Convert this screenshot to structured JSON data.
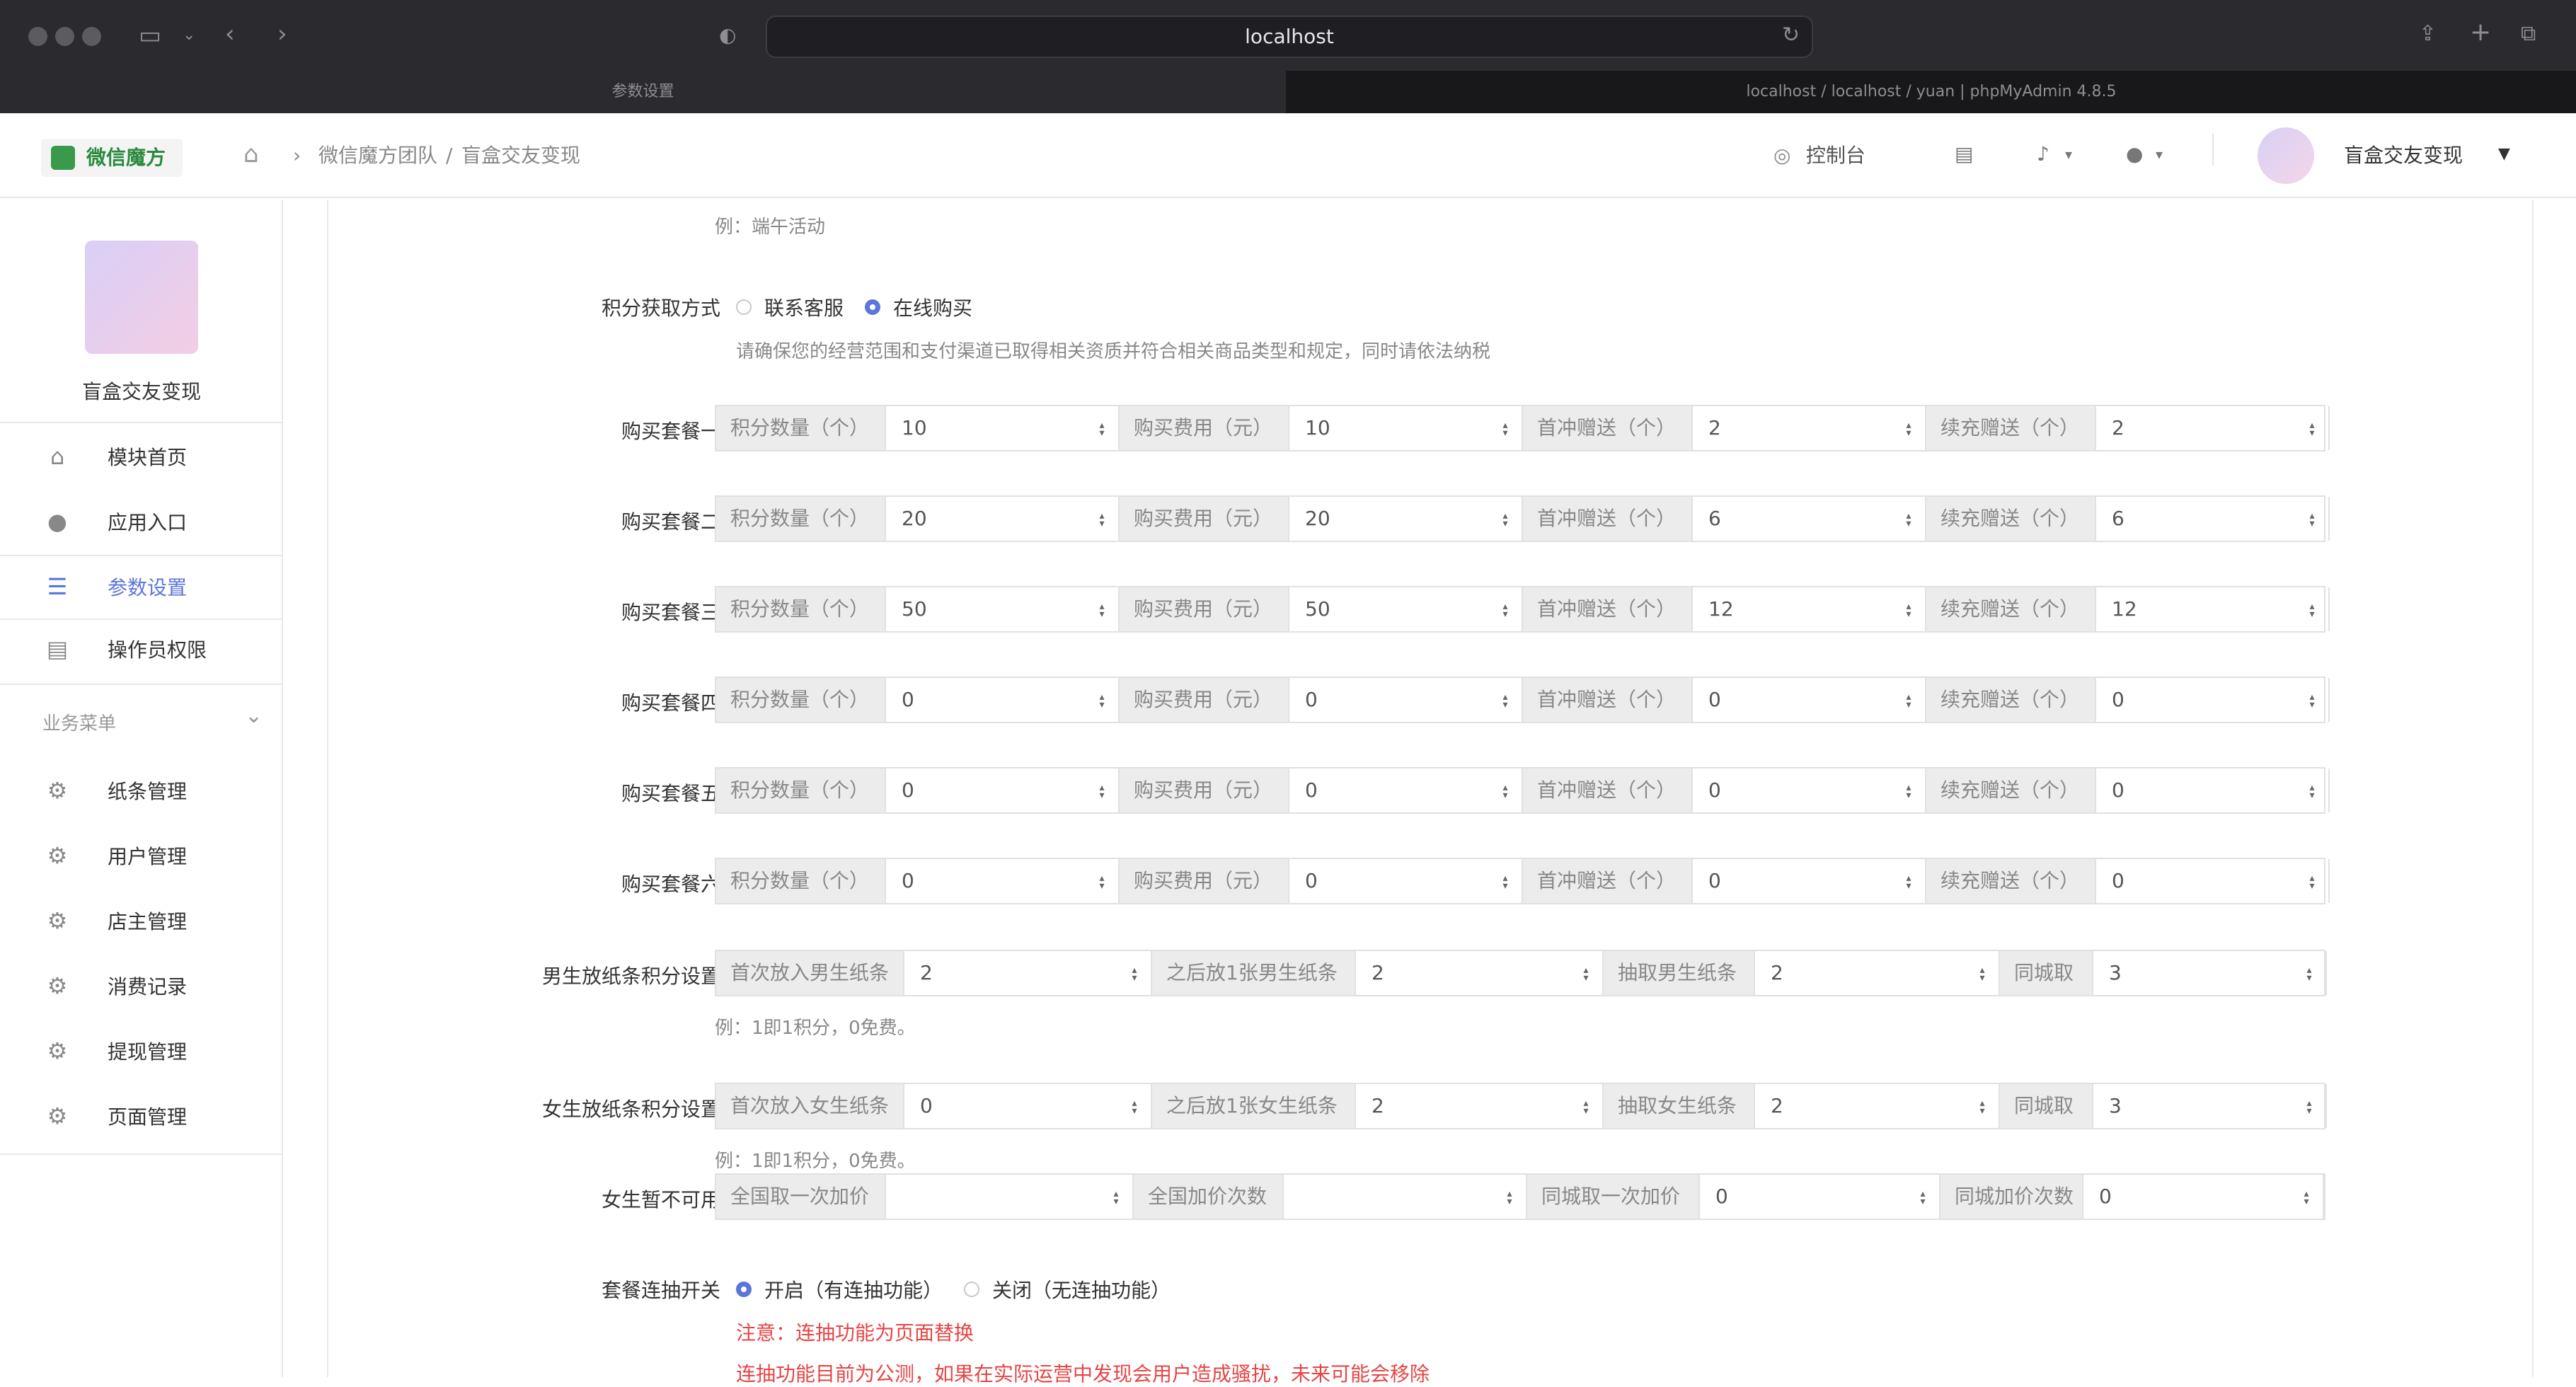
{
  "browser": {
    "url": "localhost",
    "tabs": [
      "参数设置",
      "localhost / localhost / yuan | phpMyAdmin 4.8.5"
    ]
  },
  "header": {
    "logo": "微信魔方",
    "breadcrumb": [
      "微信魔方团队",
      "盲盒交友变现"
    ],
    "console": "控制台",
    "account_name": "盲盒交友变现"
  },
  "sidebar": {
    "app_name": "盲盒交友变现",
    "items": [
      {
        "label": "模块首页",
        "icon": "home-icon"
      },
      {
        "label": "应用入口",
        "icon": "chat-icon"
      },
      {
        "label": "参数设置",
        "icon": "list-icon",
        "active": true
      },
      {
        "label": "操作员权限",
        "icon": "doc-icon"
      }
    ],
    "section": "业务菜单",
    "biz": [
      "纸条管理",
      "用户管理",
      "店主管理",
      "消费记录",
      "提现管理",
      "页面管理"
    ],
    "accent": "#5b76db"
  },
  "form": {
    "top_hint": "例：端午活动",
    "points_method": {
      "label": "积分获取方式",
      "options": [
        "联系客服",
        "在线购买"
      ],
      "selected": "在线购买",
      "hint": "请确保您的经营范围和支付渠道已取得相关资质并符合相关商品类型和规定，同时请依法纳税"
    },
    "addons": [
      "积分数量（个）",
      "购买费用（元）",
      "首冲赠送（个）",
      "续充赠送（个）"
    ],
    "packages": [
      {
        "label": "购买套餐一",
        "values": [
          "10",
          "10",
          "2",
          "2"
        ]
      },
      {
        "label": "购买套餐二",
        "values": [
          "20",
          "20",
          "6",
          "6"
        ]
      },
      {
        "label": "购买套餐三",
        "values": [
          "50",
          "50",
          "12",
          "12"
        ]
      },
      {
        "label": "购买套餐四",
        "values": [
          "0",
          "0",
          "0",
          "0"
        ]
      },
      {
        "label": "购买套餐五",
        "values": [
          "0",
          "0",
          "0",
          "0"
        ]
      },
      {
        "label": "购买套餐六",
        "values": [
          "0",
          "0",
          "0",
          "0"
        ]
      }
    ],
    "male": {
      "label": "男生放纸条积分设置",
      "addons": [
        "首次放入男生纸条",
        "之后放1张男生纸条",
        "抽取男生纸条",
        "同城取"
      ],
      "values": [
        "2",
        "2",
        "2",
        "3"
      ],
      "hint": "例：1即1积分，0免费。"
    },
    "female": {
      "label": "女生放纸条积分设置",
      "addons": [
        "首次放入女生纸条",
        "之后放1张女生纸条",
        "抽取女生纸条",
        "同城取"
      ],
      "values": [
        "0",
        "2",
        "2",
        "3"
      ],
      "hint": "例：1即1积分，0免费。"
    },
    "female_na": {
      "label": "女生暂不可用",
      "addons": [
        "全国取一次加价",
        "全国加价次数",
        "同城取一次加价",
        "同城加价次数"
      ],
      "values": [
        "",
        "",
        "0",
        "0"
      ]
    },
    "combo": {
      "label": "套餐连抽开关",
      "options": [
        "开启（有连抽功能）",
        "关闭（无连抽功能）"
      ],
      "selected": "开启（有连抽功能）",
      "warn1": "注意：连抽功能为页面替换",
      "warn2": "连抽功能目前为公测，如果在实际运营中发现会用户造成骚扰，未来可能会移除"
    }
  }
}
